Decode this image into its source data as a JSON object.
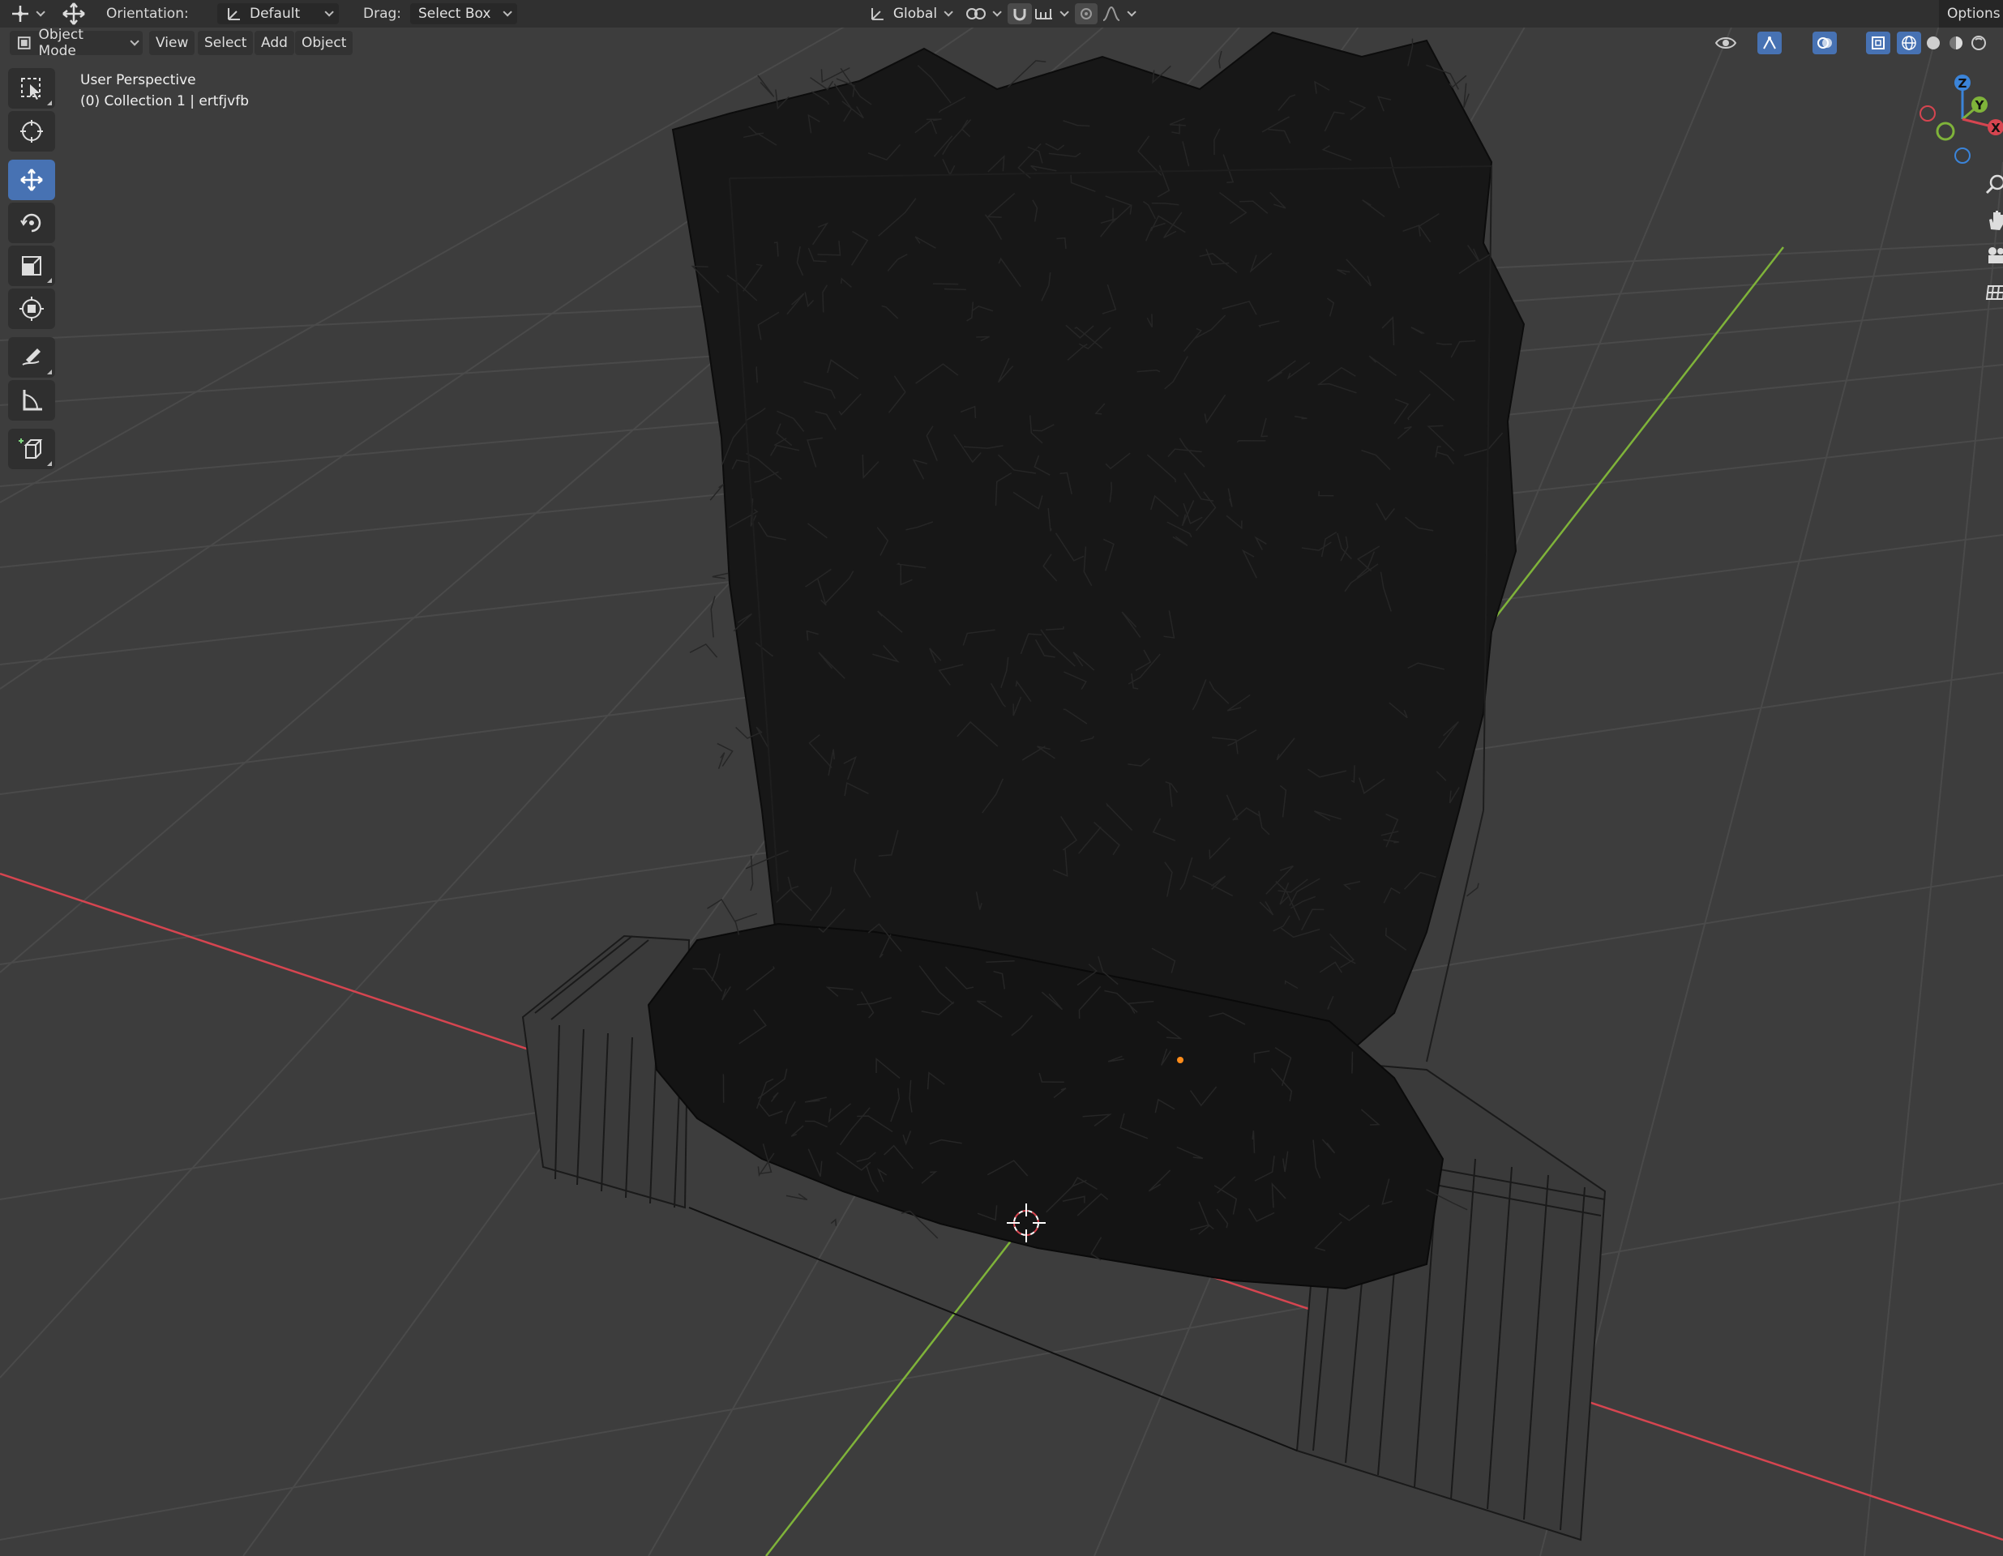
{
  "topbar": {
    "orientation_label": "Orientation:",
    "orientation_value": "Default",
    "drag_label": "Drag:",
    "drag_value": "Select Box",
    "transform_space": "Global",
    "options_label": "Options"
  },
  "header": {
    "mode": "Object Mode",
    "menus": [
      "View",
      "Select",
      "Add",
      "Object"
    ]
  },
  "viewport": {
    "view_name": "User Perspective",
    "collection_info": "(0) Collection 1 | ertfjvfb"
  },
  "gizmo": {
    "axes": [
      "Z",
      "Y",
      "X"
    ]
  },
  "colors": {
    "background": "#3d3d3d",
    "header": "#303030",
    "active_tool": "#4772b3",
    "x_axis": "#d64550",
    "y_axis": "#7fb33a",
    "z_axis": "#3b84d9",
    "grid": "#4d4d4d",
    "object": "#151515"
  },
  "toolbar": {
    "tools": [
      "select-box-icon",
      "cursor-icon",
      "move-icon",
      "rotate-icon",
      "scale-icon",
      "transform-icon",
      "annotate-icon",
      "measure-icon",
      "add-cube-icon"
    ],
    "active": "move-icon"
  },
  "navigation": [
    "zoom-icon",
    "pan-hand-icon",
    "camera-icon",
    "ortho-grid-icon"
  ]
}
